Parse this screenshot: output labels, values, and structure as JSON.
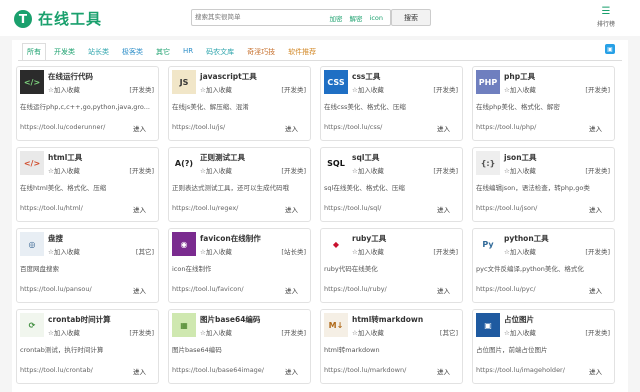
{
  "brand": {
    "title": "在线工具",
    "mark": "T",
    "color": "#1aa06d"
  },
  "search": {
    "placeholder": "搜索其实很简单",
    "links": [
      "加密",
      "解密",
      "icon"
    ],
    "button": "搜索"
  },
  "rank": {
    "icon": "ranking-icon",
    "label": "排行榜"
  },
  "tabs": [
    "所有",
    "开发类",
    "站长类",
    "极客类",
    "其它",
    "HR",
    "码农文库",
    "奇淫巧技",
    "软件推荐"
  ],
  "tools": [
    {
      "name": "在线运行代码",
      "icon": "code-run-icon",
      "fav": "☆加入收藏",
      "cat": "[开发类]",
      "desc": "在线运行php,c,c++,go,python,java,gro...",
      "url": "https://tool.lu/coderunner/",
      "go": "进入"
    },
    {
      "name": "javascript工具",
      "icon": "javascript-icon",
      "fav": "☆加入收藏",
      "cat": "[开发类]",
      "desc": "在线js美化、解压缩、混淆",
      "url": "https://tool.lu/js/",
      "go": "进入"
    },
    {
      "name": "css工具",
      "icon": "css-icon",
      "fav": "☆加入收藏",
      "cat": "[开发类]",
      "desc": "在线css美化、格式化、压缩",
      "url": "https://tool.lu/css/",
      "go": "进入"
    },
    {
      "name": "php工具",
      "icon": "php-icon",
      "fav": "☆加入收藏",
      "cat": "[开发类]",
      "desc": "在线php美化、格式化、解密",
      "url": "https://tool.lu/php/",
      "go": "进入"
    },
    {
      "name": "html工具",
      "icon": "html-icon",
      "fav": "☆加入收藏",
      "cat": "[开发类]",
      "desc": "在线html美化、格式化、压缩",
      "url": "https://tool.lu/html/",
      "go": "进入"
    },
    {
      "name": "正则测试工具",
      "icon": "regex-icon",
      "fav": "☆加入收藏",
      "cat": "[开发类]",
      "desc": "正则表达式测试工具，还可以生成代码哦",
      "url": "https://tool.lu/regex/",
      "go": "进入"
    },
    {
      "name": "sql工具",
      "icon": "sql-icon",
      "fav": "☆加入收藏",
      "cat": "[开发类]",
      "desc": "sql在线美化、格式化、压缩",
      "url": "https://tool.lu/sql/",
      "go": "进入"
    },
    {
      "name": "json工具",
      "icon": "json-icon",
      "fav": "☆加入收藏",
      "cat": "[开发类]",
      "desc": "在线编辑json，语法检查，转php,go类",
      "url": "https://tool.lu/json/",
      "go": "进入"
    },
    {
      "name": "盘搜",
      "icon": "disk-search-icon",
      "fav": "☆加入收藏",
      "cat": "[其它]",
      "desc": "百度网盘搜索",
      "url": "https://tool.lu/pansou/",
      "go": "进入"
    },
    {
      "name": "favicon在线制作",
      "icon": "favicon-icon",
      "fav": "☆加入收藏",
      "cat": "[站长类]",
      "desc": "icon在线制作",
      "url": "https://tool.lu/favicon/",
      "go": "进入"
    },
    {
      "name": "ruby工具",
      "icon": "ruby-icon",
      "fav": "☆加入收藏",
      "cat": "[开发类]",
      "desc": "ruby代码在线美化",
      "url": "https://tool.lu/ruby/",
      "go": "进入"
    },
    {
      "name": "python工具",
      "icon": "python-icon",
      "fav": "☆加入收藏",
      "cat": "[开发类]",
      "desc": "pyc文件反编译,python美化、格式化",
      "url": "https://tool.lu/pyc/",
      "go": "进入"
    },
    {
      "name": "crontab时间计算",
      "icon": "crontab-icon",
      "fav": "☆加入收藏",
      "cat": "[开发类]",
      "desc": "crontab测试，执行时间计算",
      "url": "https://tool.lu/crontab/",
      "go": "进入"
    },
    {
      "name": "图片base64编码",
      "icon": "base64-image-icon",
      "fav": "☆加入收藏",
      "cat": "[开发类]",
      "desc": "图片base64编码",
      "url": "https://tool.lu/base64image/",
      "go": "进入"
    },
    {
      "name": "html转markdown",
      "icon": "markdown-icon",
      "fav": "☆加入收藏",
      "cat": "[其它]",
      "desc": "html转markdown",
      "url": "https://tool.lu/markdown/",
      "go": "进入"
    },
    {
      "name": "占位图片",
      "icon": "placeholder-image-icon",
      "fav": "☆加入收藏",
      "cat": "[开发类]",
      "desc": "占位图片，前端占位图片",
      "url": "https://tool.lu/imageholder/",
      "go": "进入"
    }
  ]
}
